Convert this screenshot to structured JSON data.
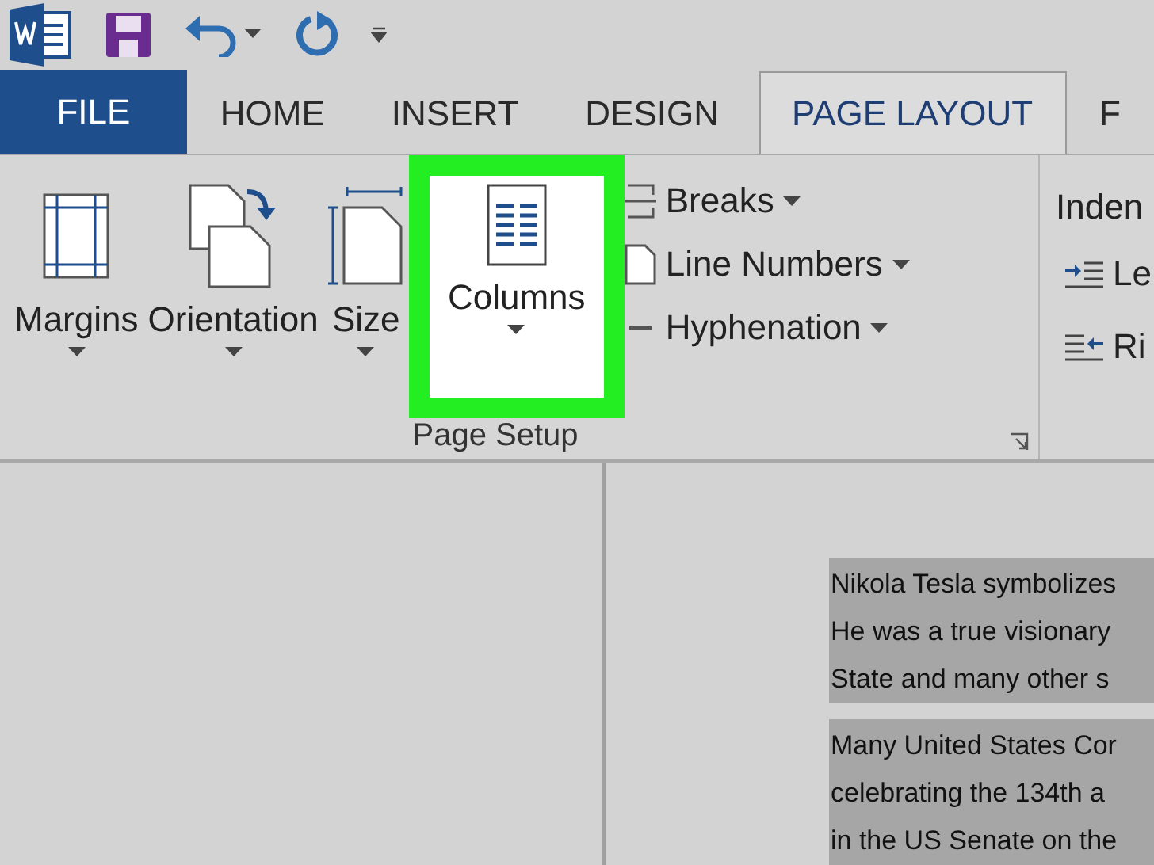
{
  "tabs": [
    {
      "label": "FILE",
      "kind": "file",
      "selected": false
    },
    {
      "label": "HOME",
      "kind": "tab",
      "selected": false
    },
    {
      "label": "INSERT",
      "kind": "tab",
      "selected": false
    },
    {
      "label": "DESIGN",
      "kind": "tab",
      "selected": false
    },
    {
      "label": "PAGE LAYOUT",
      "kind": "tab",
      "selected": true
    },
    {
      "label": "F",
      "kind": "tab",
      "selected": false
    }
  ],
  "ribbon": {
    "page_setup": {
      "label": "Page Setup",
      "large_buttons": [
        {
          "label": "Margins",
          "kind": "margins",
          "highlighted": false
        },
        {
          "label": "Orientation",
          "kind": "orientation",
          "highlighted": false
        },
        {
          "label": "Size",
          "kind": "size",
          "highlighted": false
        },
        {
          "label": "Columns",
          "kind": "columns",
          "highlighted": true
        }
      ],
      "small_buttons": [
        {
          "label": "Breaks",
          "kind": "breaks"
        },
        {
          "label": "Line Numbers",
          "kind": "line-numbers"
        },
        {
          "label": "Hyphenation",
          "kind": "hyphenation"
        }
      ]
    },
    "paragraph": {
      "label": "Inden",
      "items": [
        {
          "label": "Le",
          "kind": "indent-left"
        },
        {
          "label": "Ri",
          "kind": "indent-right"
        }
      ]
    }
  },
  "document": {
    "paragraphs": [
      {
        "selected": true,
        "lines": [
          "Nikola Tesla symbolizes",
          "He was a true visionary",
          "State and many other s"
        ]
      },
      {
        "selected": true,
        "lines": [
          "Many United States Cor",
          "celebrating the 134th a",
          "in the US Senate on the"
        ]
      }
    ]
  }
}
